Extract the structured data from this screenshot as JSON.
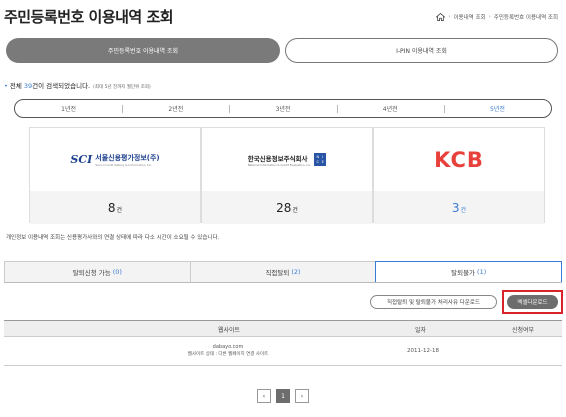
{
  "page": {
    "title": "주민등록번호 이용내역 조회",
    "breadcrumb": [
      "이용내역 조회",
      "주민등록번호 이용내역 조회"
    ]
  },
  "segment": {
    "left_label": "주민등록번호 이용내역 조회",
    "right_label": "I-PIN 이용내역 조회"
  },
  "summary": {
    "prefix": "전체 ",
    "count": "39",
    "suffix": "건이 검색되었습니다.",
    "note": "(최대 5년 전까지 월단위 조회)"
  },
  "years": [
    {
      "label": "1년전",
      "active": false
    },
    {
      "label": "2년전",
      "active": false
    },
    {
      "label": "3년전",
      "active": false
    },
    {
      "label": "4년전",
      "active": false
    },
    {
      "label": "5년전",
      "active": true
    }
  ],
  "agencies": [
    {
      "logo_mark": "SCI",
      "name": "서울신용평가정보(주)",
      "name_en": "Seoul Credit Rating & Information Inc.",
      "count": "8",
      "unit": "건"
    },
    {
      "name": "한국신용정보주식회사",
      "name_en": "National Information & Credit Evaluation, Inc.",
      "badge": [
        "N",
        "I",
        "C",
        "E"
      ],
      "count": "28",
      "unit": "건"
    },
    {
      "logo_text": "KCB",
      "count": "3",
      "unit": "건"
    }
  ],
  "notice": "개인정보 이용내역 조회는 신용평가사와의 연결 상태에 따라 다소 시간이 소요될 수 있습니다.",
  "tabs": [
    {
      "label": "탈퇴신청 가능",
      "count": "(0)"
    },
    {
      "label": "직접탈퇴",
      "count": "(2)"
    },
    {
      "label": "탈퇴불가",
      "count": "(1)"
    }
  ],
  "buttons": {
    "reason_download": "직접탈퇴 및 탈퇴불가 처리사유 다운로드",
    "excel_download": "엑셀다운로드"
  },
  "table": {
    "headers": [
      "웹사이트",
      "일자",
      "신청여부"
    ],
    "rows": [
      {
        "site": "dabayo.com",
        "status": "웹사이트 상태 : 다른 웹페이지 연결 사이트",
        "date": "2011-12-18",
        "applied": ""
      }
    ]
  },
  "pager": {
    "prev": "‹",
    "current": "1",
    "next": "›"
  },
  "colors": {
    "accent": "#3a7bd5",
    "highlight": "#d8232a",
    "kcb_red": "#e8413b"
  }
}
